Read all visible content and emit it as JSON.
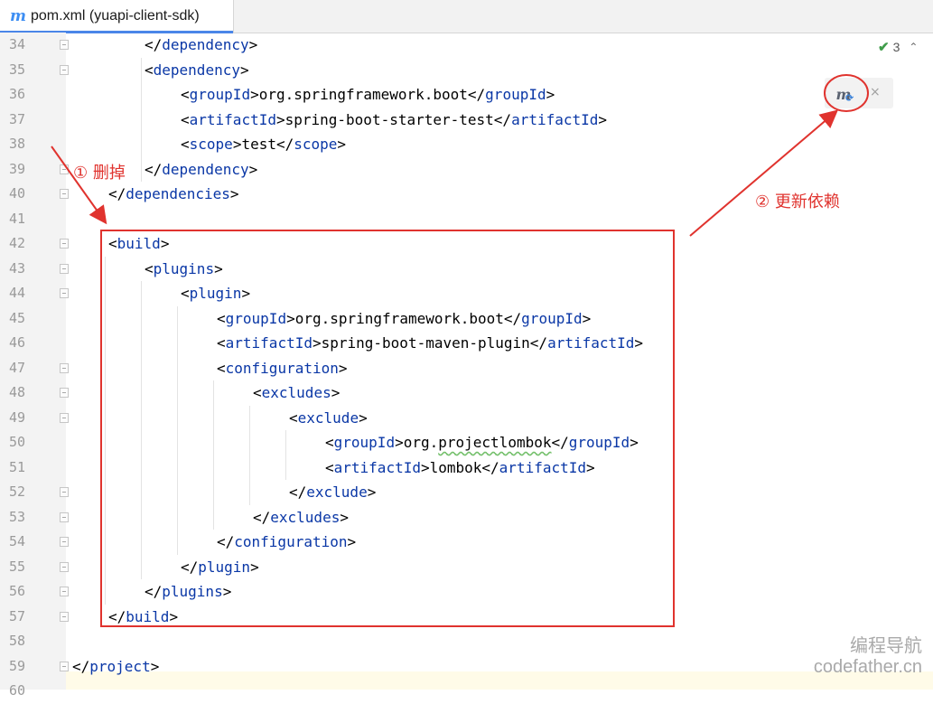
{
  "tab": {
    "icon": "maven-m-icon",
    "title": "pom.xml (yuapi-client-sdk)"
  },
  "inspection": {
    "count": "3",
    "icon": "check-icon"
  },
  "maven_button": {
    "icon": "maven-reload-icon",
    "letter": "m",
    "close": "×"
  },
  "lines": [
    {
      "num": "34",
      "indent": 2,
      "tokens": [
        [
          "br",
          "</"
        ],
        [
          "tag",
          "dependency"
        ],
        [
          "br",
          ">"
        ]
      ],
      "fold": true
    },
    {
      "num": "35",
      "indent": 2,
      "tokens": [
        [
          "br",
          "<"
        ],
        [
          "tag",
          "dependency"
        ],
        [
          "br",
          ">"
        ]
      ],
      "fold": true
    },
    {
      "num": "36",
      "indent": 3,
      "tokens": [
        [
          "br",
          "<"
        ],
        [
          "tag",
          "groupId"
        ],
        [
          "br",
          ">"
        ],
        [
          "txt",
          "org.springframework.boot"
        ],
        [
          "br",
          "</"
        ],
        [
          "tag",
          "groupId"
        ],
        [
          "br",
          ">"
        ]
      ]
    },
    {
      "num": "37",
      "indent": 3,
      "tokens": [
        [
          "br",
          "<"
        ],
        [
          "tag",
          "artifactId"
        ],
        [
          "br",
          ">"
        ],
        [
          "txt",
          "spring-boot-starter-test"
        ],
        [
          "br",
          "</"
        ],
        [
          "tag",
          "artifactId"
        ],
        [
          "br",
          ">"
        ]
      ]
    },
    {
      "num": "38",
      "indent": 3,
      "tokens": [
        [
          "br",
          "<"
        ],
        [
          "tag",
          "scope"
        ],
        [
          "br",
          ">"
        ],
        [
          "txt",
          "test"
        ],
        [
          "br",
          "</"
        ],
        [
          "tag",
          "scope"
        ],
        [
          "br",
          ">"
        ]
      ]
    },
    {
      "num": "39",
      "indent": 2,
      "tokens": [
        [
          "br",
          "</"
        ],
        [
          "tag",
          "dependency"
        ],
        [
          "br",
          ">"
        ]
      ],
      "fold": true
    },
    {
      "num": "40",
      "indent": 1,
      "tokens": [
        [
          "br",
          "</"
        ],
        [
          "tag",
          "dependencies"
        ],
        [
          "br",
          ">"
        ]
      ],
      "fold": true
    },
    {
      "num": "41",
      "indent": 0,
      "tokens": []
    },
    {
      "num": "42",
      "indent": 1,
      "tokens": [
        [
          "br",
          "<"
        ],
        [
          "tag",
          "build"
        ],
        [
          "br",
          ">"
        ]
      ],
      "fold": true
    },
    {
      "num": "43",
      "indent": 2,
      "tokens": [
        [
          "br",
          "<"
        ],
        [
          "tag",
          "plugins"
        ],
        [
          "br",
          ">"
        ]
      ],
      "fold": true
    },
    {
      "num": "44",
      "indent": 3,
      "tokens": [
        [
          "br",
          "<"
        ],
        [
          "tag",
          "plugin"
        ],
        [
          "br",
          ">"
        ]
      ],
      "fold": true
    },
    {
      "num": "45",
      "indent": 4,
      "tokens": [
        [
          "br",
          "<"
        ],
        [
          "tag",
          "groupId"
        ],
        [
          "br",
          ">"
        ],
        [
          "txt",
          "org.springframework.boot"
        ],
        [
          "br",
          "</"
        ],
        [
          "tag",
          "groupId"
        ],
        [
          "br",
          ">"
        ]
      ]
    },
    {
      "num": "46",
      "indent": 4,
      "tokens": [
        [
          "br",
          "<"
        ],
        [
          "tag",
          "artifactId"
        ],
        [
          "br",
          ">"
        ],
        [
          "txt",
          "spring-boot-maven-plugin"
        ],
        [
          "br",
          "</"
        ],
        [
          "tag",
          "artifactId"
        ],
        [
          "br",
          ">"
        ]
      ]
    },
    {
      "num": "47",
      "indent": 4,
      "tokens": [
        [
          "br",
          "<"
        ],
        [
          "tag",
          "configuration"
        ],
        [
          "br",
          ">"
        ]
      ],
      "fold": true
    },
    {
      "num": "48",
      "indent": 5,
      "tokens": [
        [
          "br",
          "<"
        ],
        [
          "tag",
          "excludes"
        ],
        [
          "br",
          ">"
        ]
      ],
      "fold": true
    },
    {
      "num": "49",
      "indent": 6,
      "tokens": [
        [
          "br",
          "<"
        ],
        [
          "tag",
          "exclude"
        ],
        [
          "br",
          ">"
        ]
      ],
      "fold": true
    },
    {
      "num": "50",
      "indent": 7,
      "tokens": [
        [
          "br",
          "<"
        ],
        [
          "tag",
          "groupId"
        ],
        [
          "br",
          ">"
        ],
        [
          "txt",
          "org."
        ],
        [
          "sq",
          "projectlombok"
        ],
        [
          "br",
          "</"
        ],
        [
          "tag",
          "groupId"
        ],
        [
          "br",
          ">"
        ]
      ]
    },
    {
      "num": "51",
      "indent": 7,
      "tokens": [
        [
          "br",
          "<"
        ],
        [
          "tag",
          "artifactId"
        ],
        [
          "br",
          ">"
        ],
        [
          "txt",
          "lombok"
        ],
        [
          "br",
          "</"
        ],
        [
          "tag",
          "artifactId"
        ],
        [
          "br",
          ">"
        ]
      ]
    },
    {
      "num": "52",
      "indent": 6,
      "tokens": [
        [
          "br",
          "</"
        ],
        [
          "tag",
          "exclude"
        ],
        [
          "br",
          ">"
        ]
      ],
      "fold": true
    },
    {
      "num": "53",
      "indent": 5,
      "tokens": [
        [
          "br",
          "</"
        ],
        [
          "tag",
          "excludes"
        ],
        [
          "br",
          ">"
        ]
      ],
      "fold": true
    },
    {
      "num": "54",
      "indent": 4,
      "tokens": [
        [
          "br",
          "</"
        ],
        [
          "tag",
          "configuration"
        ],
        [
          "br",
          ">"
        ]
      ],
      "fold": true
    },
    {
      "num": "55",
      "indent": 3,
      "tokens": [
        [
          "br",
          "</"
        ],
        [
          "tag",
          "plugin"
        ],
        [
          "br",
          ">"
        ]
      ],
      "fold": true
    },
    {
      "num": "56",
      "indent": 2,
      "tokens": [
        [
          "br",
          "</"
        ],
        [
          "tag",
          "plugins"
        ],
        [
          "br",
          ">"
        ]
      ],
      "fold": true
    },
    {
      "num": "57",
      "indent": 1,
      "tokens": [
        [
          "br",
          "</"
        ],
        [
          "tag",
          "build"
        ],
        [
          "br",
          ">"
        ]
      ],
      "fold": true
    },
    {
      "num": "58",
      "indent": 0,
      "tokens": []
    },
    {
      "num": "59",
      "indent": 0,
      "tokens": [
        [
          "br",
          "</"
        ],
        [
          "tag",
          "project"
        ],
        [
          "br",
          ">"
        ]
      ],
      "fold": true
    },
    {
      "num": "60",
      "indent": 0,
      "tokens": []
    }
  ],
  "annotations": {
    "delete_label": "① 删掉",
    "update_label": "② 更新依赖"
  },
  "watermark": {
    "line1": "编程导航",
    "line2": "codefather.cn"
  },
  "colors": {
    "annotation": "#e0332e",
    "tag": "#0a37a6",
    "accent": "#4a86e8"
  }
}
